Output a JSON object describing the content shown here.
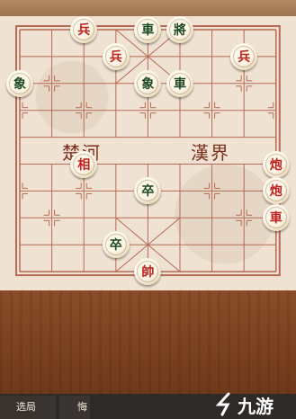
{
  "board": {
    "river_left": "楚河",
    "river_right": "漢界",
    "pieces": [
      {
        "char": "兵",
        "side": "red",
        "name": "red-soldier-1",
        "col": 2,
        "row": 0
      },
      {
        "char": "車",
        "side": "black",
        "name": "black-chariot-1",
        "col": 4,
        "row": 0
      },
      {
        "char": "將",
        "side": "black",
        "name": "black-general",
        "col": 5,
        "row": 0
      },
      {
        "char": "兵",
        "side": "red",
        "name": "red-soldier-2",
        "col": 3,
        "row": 1
      },
      {
        "char": "兵",
        "side": "red",
        "name": "red-soldier-3",
        "col": 7,
        "row": 1
      },
      {
        "char": "象",
        "side": "black",
        "name": "black-elephant-1",
        "col": 0,
        "row": 2
      },
      {
        "char": "象",
        "side": "black",
        "name": "black-elephant-2",
        "col": 4,
        "row": 2
      },
      {
        "char": "車",
        "side": "black",
        "name": "black-chariot-2",
        "col": 5,
        "row": 2
      },
      {
        "char": "相",
        "side": "red",
        "name": "red-elephant",
        "col": 2,
        "row": 5
      },
      {
        "char": "炮",
        "side": "red",
        "name": "red-cannon-1",
        "col": 8,
        "row": 5
      },
      {
        "char": "炮",
        "side": "red",
        "name": "red-cannon-2",
        "col": 8,
        "row": 6
      },
      {
        "char": "卒",
        "side": "black",
        "name": "black-soldier-1",
        "col": 4,
        "row": 6
      },
      {
        "char": "車",
        "side": "red",
        "name": "red-chariot",
        "col": 8,
        "row": 7
      },
      {
        "char": "卒",
        "side": "black",
        "name": "black-soldier-2",
        "col": 3,
        "row": 8
      },
      {
        "char": "帥",
        "side": "red",
        "name": "red-king",
        "col": 4,
        "row": 9
      }
    ]
  },
  "toolbar": {
    "select_game": "选局",
    "undo": "悔"
  },
  "watermark": {
    "text": "九游"
  },
  "colors": {
    "red_piece": "#c0201d",
    "black_piece": "#1d4a22",
    "grid": "#b56a55"
  }
}
